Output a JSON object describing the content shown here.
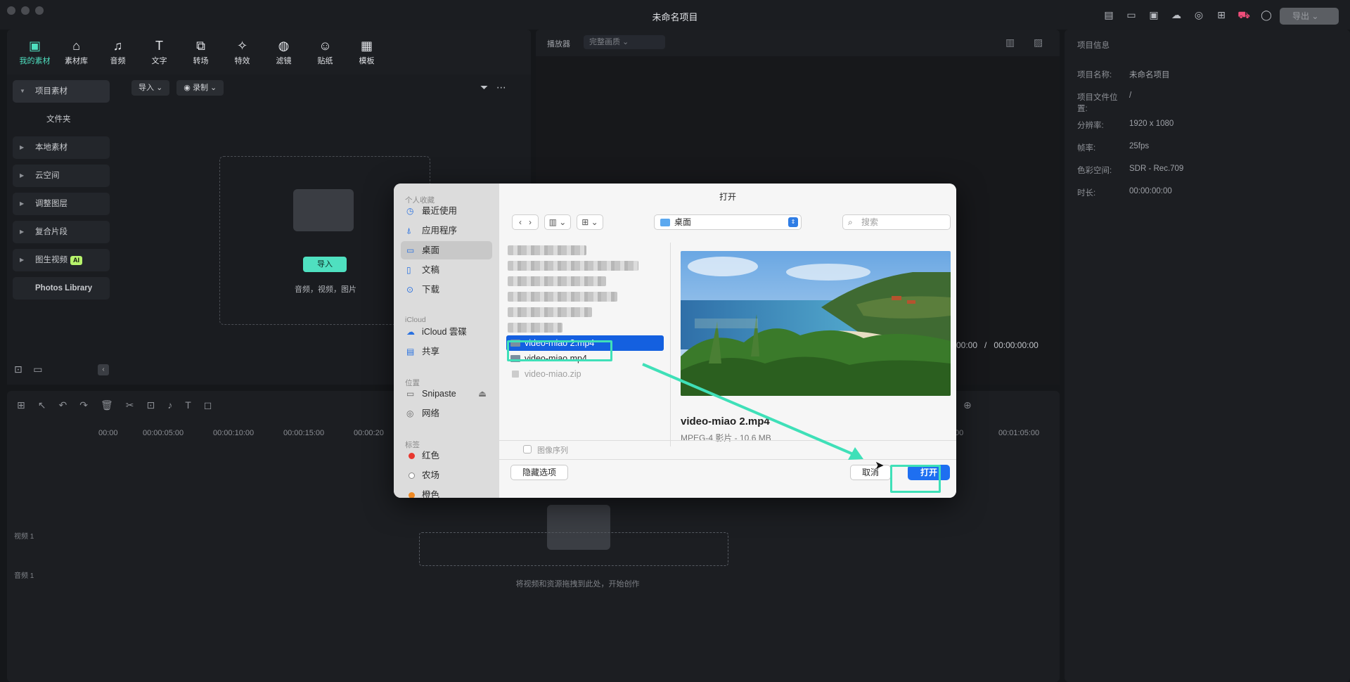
{
  "window": {
    "title": "未命名项目",
    "export_label": "导出"
  },
  "toolbar": {
    "items": [
      {
        "label": "我的素材",
        "icon": "folder-media-icon",
        "active": true
      },
      {
        "label": "素材库",
        "icon": "store-icon"
      },
      {
        "label": "音频",
        "icon": "music-note-icon"
      },
      {
        "label": "文字",
        "icon": "text-icon"
      },
      {
        "label": "转场",
        "icon": "transition-icon"
      },
      {
        "label": "特效",
        "icon": "effects-icon"
      },
      {
        "label": "滤镜",
        "icon": "filter-icon"
      },
      {
        "label": "贴纸",
        "icon": "sticker-icon"
      },
      {
        "label": "模板",
        "icon": "template-icon"
      }
    ]
  },
  "sidebar": {
    "items": [
      {
        "label": "项目素材"
      },
      {
        "label": "文件夹"
      },
      {
        "label": "本地素材"
      },
      {
        "label": "云空间"
      },
      {
        "label": "调整图层"
      },
      {
        "label": "复合片段"
      },
      {
        "label": "图生视频",
        "badge": "AI"
      },
      {
        "label": "Photos Library"
      }
    ]
  },
  "media": {
    "import_dropdown": "导入",
    "record_dropdown": "录制",
    "import_button": "导入",
    "drop_caption": "音频，视频，图片"
  },
  "player": {
    "label": "播放器",
    "quality": "完整画质",
    "timecode_current": "00:00",
    "timecode_sep": "/",
    "timecode_total": "00:00:00:00"
  },
  "info": {
    "header": "项目信息",
    "rows": [
      {
        "key": "项目名称:",
        "value": "未命名项目"
      },
      {
        "key": "项目文件位置:",
        "value": "/"
      },
      {
        "key": "分辨率:",
        "value": "1920 x 1080"
      },
      {
        "key": "帧率:",
        "value": "25fps"
      },
      {
        "key": "色彩空间:",
        "value": "SDR - Rec.709"
      },
      {
        "key": "时长:",
        "value": "00:00:00:00"
      }
    ]
  },
  "timeline": {
    "ruler": [
      "00:00",
      "00:00:05:00",
      "00:00:10:00",
      "00:00:15:00",
      "00:00:20",
      ":00",
      "00:01:05:00"
    ],
    "video_track": "视频 1",
    "audio_track": "音频 1",
    "hint": "将视频和资源拖拽到此处，开始创作"
  },
  "dialog": {
    "title": "打开",
    "sections": {
      "favorites": "个人收藏",
      "icloud": "iCloud",
      "locations": "位置",
      "tags": "标签"
    },
    "favorites": [
      {
        "label": "最近使用",
        "icon": "clock-icon"
      },
      {
        "label": "应用程序",
        "icon": "apps-icon"
      },
      {
        "label": "桌面",
        "icon": "desktop-icon",
        "selected": true
      },
      {
        "label": "文稿",
        "icon": "document-icon"
      },
      {
        "label": "下载",
        "icon": "download-icon"
      }
    ],
    "icloud_items": [
      {
        "label": "iCloud 雲碟",
        "icon": "cloud-icon"
      },
      {
        "label": "共享",
        "icon": "shared-folder-icon"
      }
    ],
    "locations": [
      {
        "label": "Snipaste",
        "icon": "drive-icon"
      },
      {
        "label": "网络",
        "icon": "globe-icon"
      }
    ],
    "tags": [
      {
        "label": "红色",
        "color": "#e8382f"
      },
      {
        "label": "农场",
        "color": "#ffffff"
      },
      {
        "label": "橙色",
        "color": "#f08a24"
      }
    ],
    "location_select": "桌面",
    "search_placeholder": "搜索",
    "files": [
      {
        "name": "video-miao 2.mp4",
        "selected": true
      },
      {
        "name": "video-miao.mp4"
      },
      {
        "name": "video-miao.zip",
        "dim": true
      }
    ],
    "preview": {
      "name": "video-miao 2.mp4",
      "meta": "MPEG-4 影片 - 10.6 MB"
    },
    "image_sequence": "图像序列",
    "hide_options": "隐藏选项",
    "cancel": "取消",
    "open": "打开"
  },
  "colors": {
    "accent": "#4fe0c0",
    "highlight": "#3fe0b8",
    "selection": "#1460e0",
    "primary_button": "#1e6ff1"
  }
}
